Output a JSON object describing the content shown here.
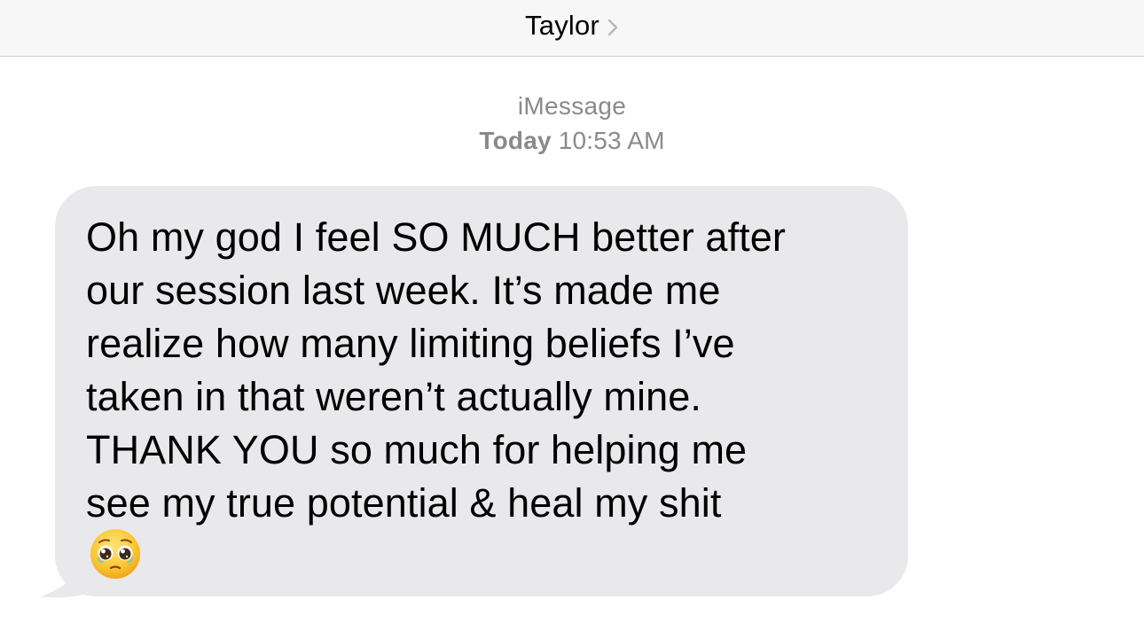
{
  "header": {
    "contact_name": "Taylor",
    "chevron_icon": "chevron-right-icon"
  },
  "conversation": {
    "service_label": "iMessage",
    "timestamp_day": "Today",
    "timestamp_time": "10:53 AM"
  },
  "message": {
    "direction": "incoming",
    "text": "Oh my god I feel SO MUCH better after\nour session last week. It’s made me\nrealize how many limiting beliefs I’ve\ntaken in that weren’t actually mine.\nTHANK YOU so much for helping me\nsee my true potential & heal my shit",
    "emoji": "pleading-face-icon"
  },
  "colors": {
    "header_bg": "#f7f7f7",
    "bubble_bg": "#e9e9eb",
    "meta_text": "#8a8a8e",
    "chevron": "#b8b8bc"
  }
}
